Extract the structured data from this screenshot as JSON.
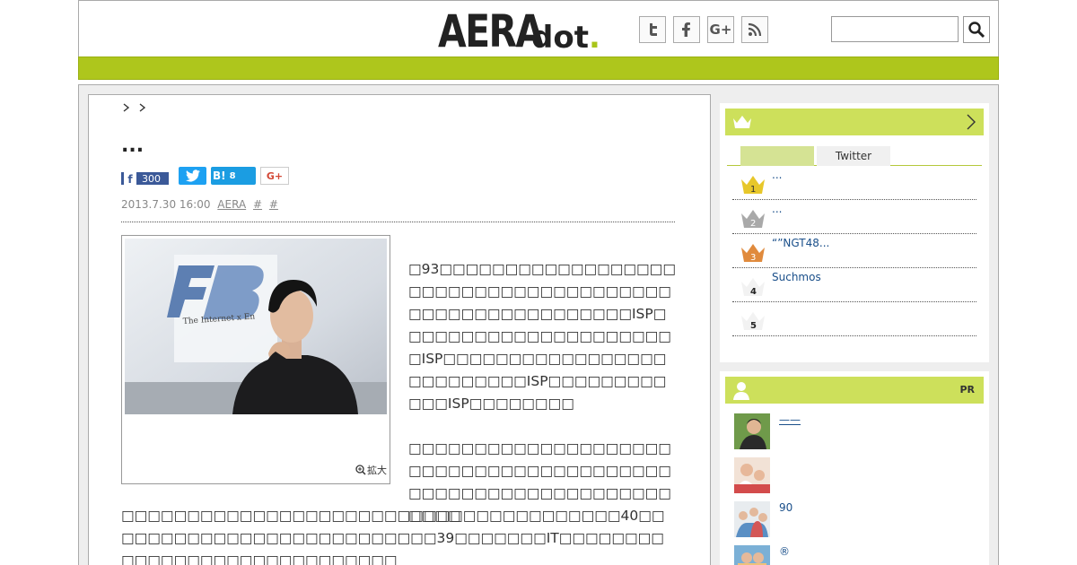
{
  "header": {
    "logo_main": "AERA",
    "logo_sub": "dot",
    "logo_period": ".",
    "social": [
      {
        "name": "twitter",
        "glyph": "t"
      },
      {
        "name": "facebook",
        "glyph": "f"
      },
      {
        "name": "google-plus",
        "glyph": "G+"
      },
      {
        "name": "rss",
        "glyph": "rss"
      }
    ],
    "search_value": ""
  },
  "article": {
    "breadcrumb": "> >",
    "title": "...",
    "share": {
      "facebook_count": "300",
      "hatena_label": "B!",
      "hatena_count": "8",
      "googleplus_label": "G+"
    },
    "date": "2013.7.30 16:00",
    "source": "AERA",
    "tag1": "#",
    "tag2": "#",
    "zoom_label": "拡大",
    "photo_caption_text": "The Internet x En",
    "paragraph1": "□93□□□□□□□□□□□□□□□□□□□□□□□□□□□□□□□□□□□□□□□□□□□□□□□□□□□□□□□ISP□□□□□□□□□□□□□□□□□□□□□□ISP□□□□□□□□□□□□□□□□□□□□□□□□□□ISP□□□□□□□□□□□□ISP□□□□□□□□",
    "paragraph2": "□□□□□□□□□□□□□□□□□□□□□□□□□□□□□□□□□□□□□□□□□□□□□□□□□□□□□□□□□□□□□□□□",
    "paragraph3": "□□□□□□□□□□□□□□□□□□□□□□□□□□□□□□□□□□□□□□40□□□□□□□□□□□□□□□□□□□□□□□□□□39□□□□□□□IT□□□□□□□□□□□□□□□□□□□□□□□□□□□□□"
  },
  "ranking": {
    "tabs": [
      "",
      "Twitter"
    ],
    "items": [
      {
        "rank": "1",
        "text": "...",
        "color": "#e7c72a"
      },
      {
        "rank": "2",
        "text": "...",
        "color": "#a9a9a9"
      },
      {
        "rank": "3",
        "text": "“”NGT48...",
        "color": "#e08a3c"
      },
      {
        "rank": "4",
        "text": "Suchmos",
        "color": "#f2f2f2"
      },
      {
        "rank": "5",
        "text": "",
        "color": "#f2f2f2"
      }
    ]
  },
  "pr": {
    "label": "PR",
    "items": [
      {
        "text": "——"
      },
      {
        "text": ""
      },
      {
        "text": "90"
      },
      {
        "text": "®"
      }
    ]
  },
  "colors": {
    "accent": "#aec61c",
    "side_head": "#cde05b",
    "link": "#1a4f8a"
  }
}
